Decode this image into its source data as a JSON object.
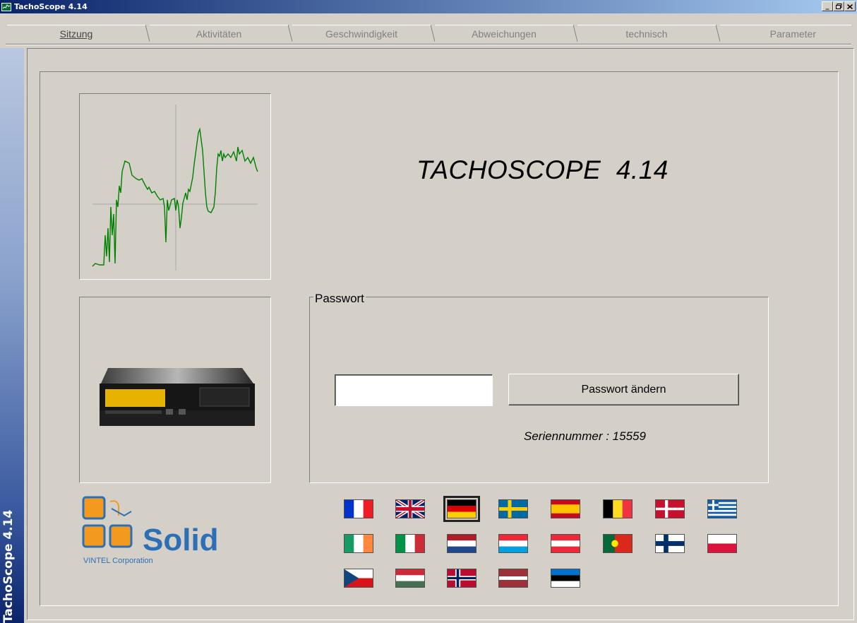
{
  "window": {
    "title": "TachoScope 4.14",
    "buttons": [
      "_",
      "´",
      "×"
    ]
  },
  "tabs": [
    {
      "label": "Sitzung",
      "active": true
    },
    {
      "label": "Aktivitäten",
      "active": false
    },
    {
      "label": "Geschwindigkeit",
      "active": false
    },
    {
      "label": "Abweichungen",
      "active": false
    },
    {
      "label": "technisch",
      "active": false
    },
    {
      "label": "Parameter",
      "active": false
    }
  ],
  "sidebar": {
    "label": "TachoScope 4.14"
  },
  "main": {
    "heading": "TACHOSCOPE  4.14",
    "password_group": {
      "legend": "Passwort",
      "input_value": "",
      "change_button": "Passwort ändern",
      "serial": "Seriennummer : 15559"
    }
  },
  "logo": {
    "name": "Solid",
    "subtitle": "VINTEL Corporation"
  },
  "languages": [
    {
      "code": "fr",
      "icon": "flag-france-icon"
    },
    {
      "code": "en",
      "icon": "flag-uk-icon"
    },
    {
      "code": "de",
      "icon": "flag-germany-icon",
      "selected": true
    },
    {
      "code": "sv",
      "icon": "flag-sweden-icon"
    },
    {
      "code": "es",
      "icon": "flag-spain-icon"
    },
    {
      "code": "be",
      "icon": "flag-belgium-icon"
    },
    {
      "code": "da",
      "icon": "flag-denmark-icon"
    },
    {
      "code": "el",
      "icon": "flag-greece-icon"
    },
    {
      "code": "ie",
      "icon": "flag-ireland-icon"
    },
    {
      "code": "it",
      "icon": "flag-italy-icon"
    },
    {
      "code": "nl",
      "icon": "flag-netherlands-icon"
    },
    {
      "code": "lu",
      "icon": "flag-luxembourg-icon"
    },
    {
      "code": "at",
      "icon": "flag-austria-icon"
    },
    {
      "code": "pt",
      "icon": "flag-portugal-icon"
    },
    {
      "code": "fi",
      "icon": "flag-finland-icon"
    },
    {
      "code": "pl",
      "icon": "flag-poland-icon"
    },
    {
      "code": "cz",
      "icon": "flag-czech-icon"
    },
    {
      "code": "hu",
      "icon": "flag-hungary-icon"
    },
    {
      "code": "no",
      "icon": "flag-norway-icon"
    },
    {
      "code": "lv",
      "icon": "flag-latvia-icon"
    },
    {
      "code": "ee",
      "icon": "flag-estonia-icon"
    }
  ],
  "colors": {
    "chart_line": "#008000",
    "logo_orange": "#f39a1e",
    "logo_blue": "#2d6fb6"
  }
}
